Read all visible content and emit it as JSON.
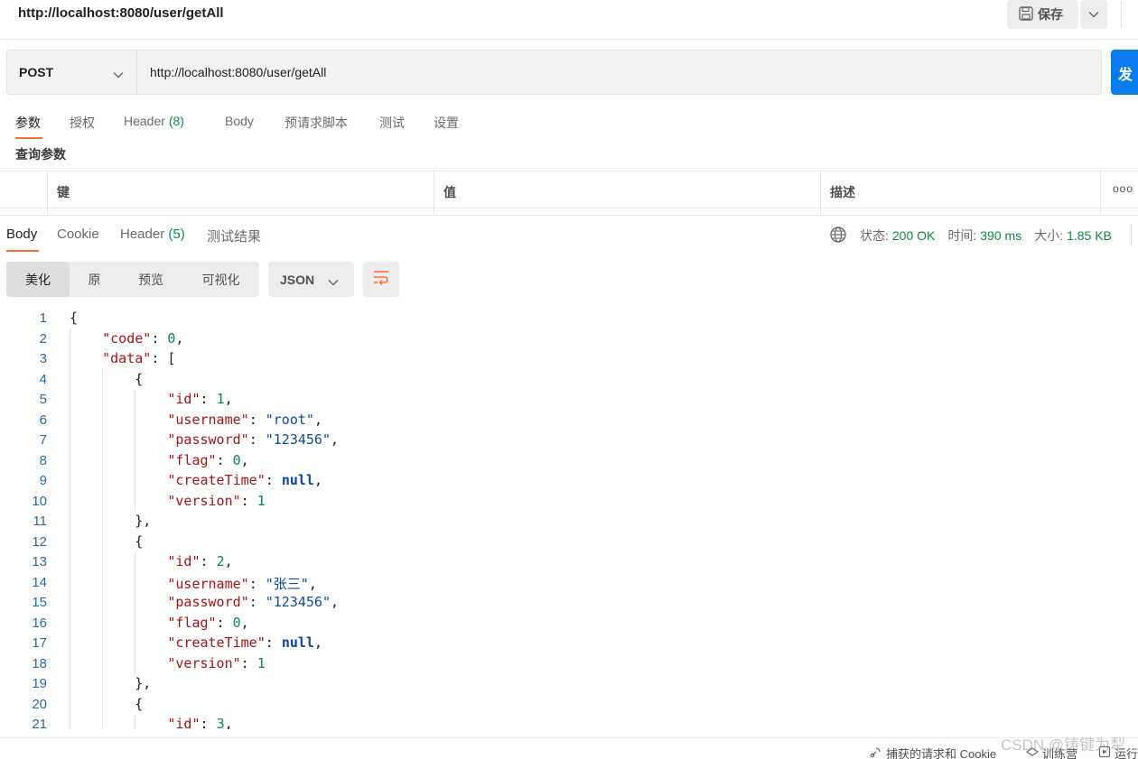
{
  "header": {
    "title": "http://localhost:8080/user/getAll",
    "save_label": "保存"
  },
  "request": {
    "method": "POST",
    "url": "http://localhost:8080/user/getAll",
    "send_label": "发"
  },
  "request_tabs": [
    {
      "label": "参数"
    },
    {
      "label": "授权"
    },
    {
      "label": "Header",
      "count": "(8)"
    },
    {
      "label": "Body"
    },
    {
      "label": "预请求脚本"
    },
    {
      "label": "测试"
    },
    {
      "label": "设置"
    }
  ],
  "query_params": {
    "section_label": "查询参数",
    "columns": [
      "键",
      "值",
      "描述"
    ],
    "more_label": "ooo"
  },
  "response_tabs": [
    {
      "label": "Body"
    },
    {
      "label": "Cookie"
    },
    {
      "label": "Header",
      "count": "(5)"
    },
    {
      "label": "测试结果"
    }
  ],
  "response_status": {
    "status_label": "状态:",
    "status_value": "200 OK",
    "time_label": "时间:",
    "time_value": "390 ms",
    "size_label": "大小:",
    "size_value": "1.85 KB"
  },
  "view_modes": [
    "美化",
    "原",
    "预览",
    "可视化"
  ],
  "format": "JSON",
  "code_lines": [
    "{",
    "    \"code\": 0,",
    "    \"data\": [",
    "        {",
    "            \"id\": 1,",
    "            \"username\": \"root\",",
    "            \"password\": \"123456\",",
    "            \"flag\": 0,",
    "            \"createTime\": null,",
    "            \"version\": 1",
    "        },",
    "        {",
    "            \"id\": 2,",
    "            \"username\": \"张三\",",
    "            \"password\": \"123456\",",
    "            \"flag\": 0,",
    "            \"createTime\": null,",
    "            \"version\": 1",
    "        },",
    "        {",
    "            \"id\": 3,"
  ],
  "footer": {
    "capture_label": "捕获的请求和 Cookie",
    "bootcamp_label": "训练营",
    "runner_label": "运行"
  },
  "watermark": "CSDN @铸键为犁",
  "colors": {
    "accent": "#ff6c37",
    "send_button": "#097bed",
    "success": "#0f8a3e"
  }
}
